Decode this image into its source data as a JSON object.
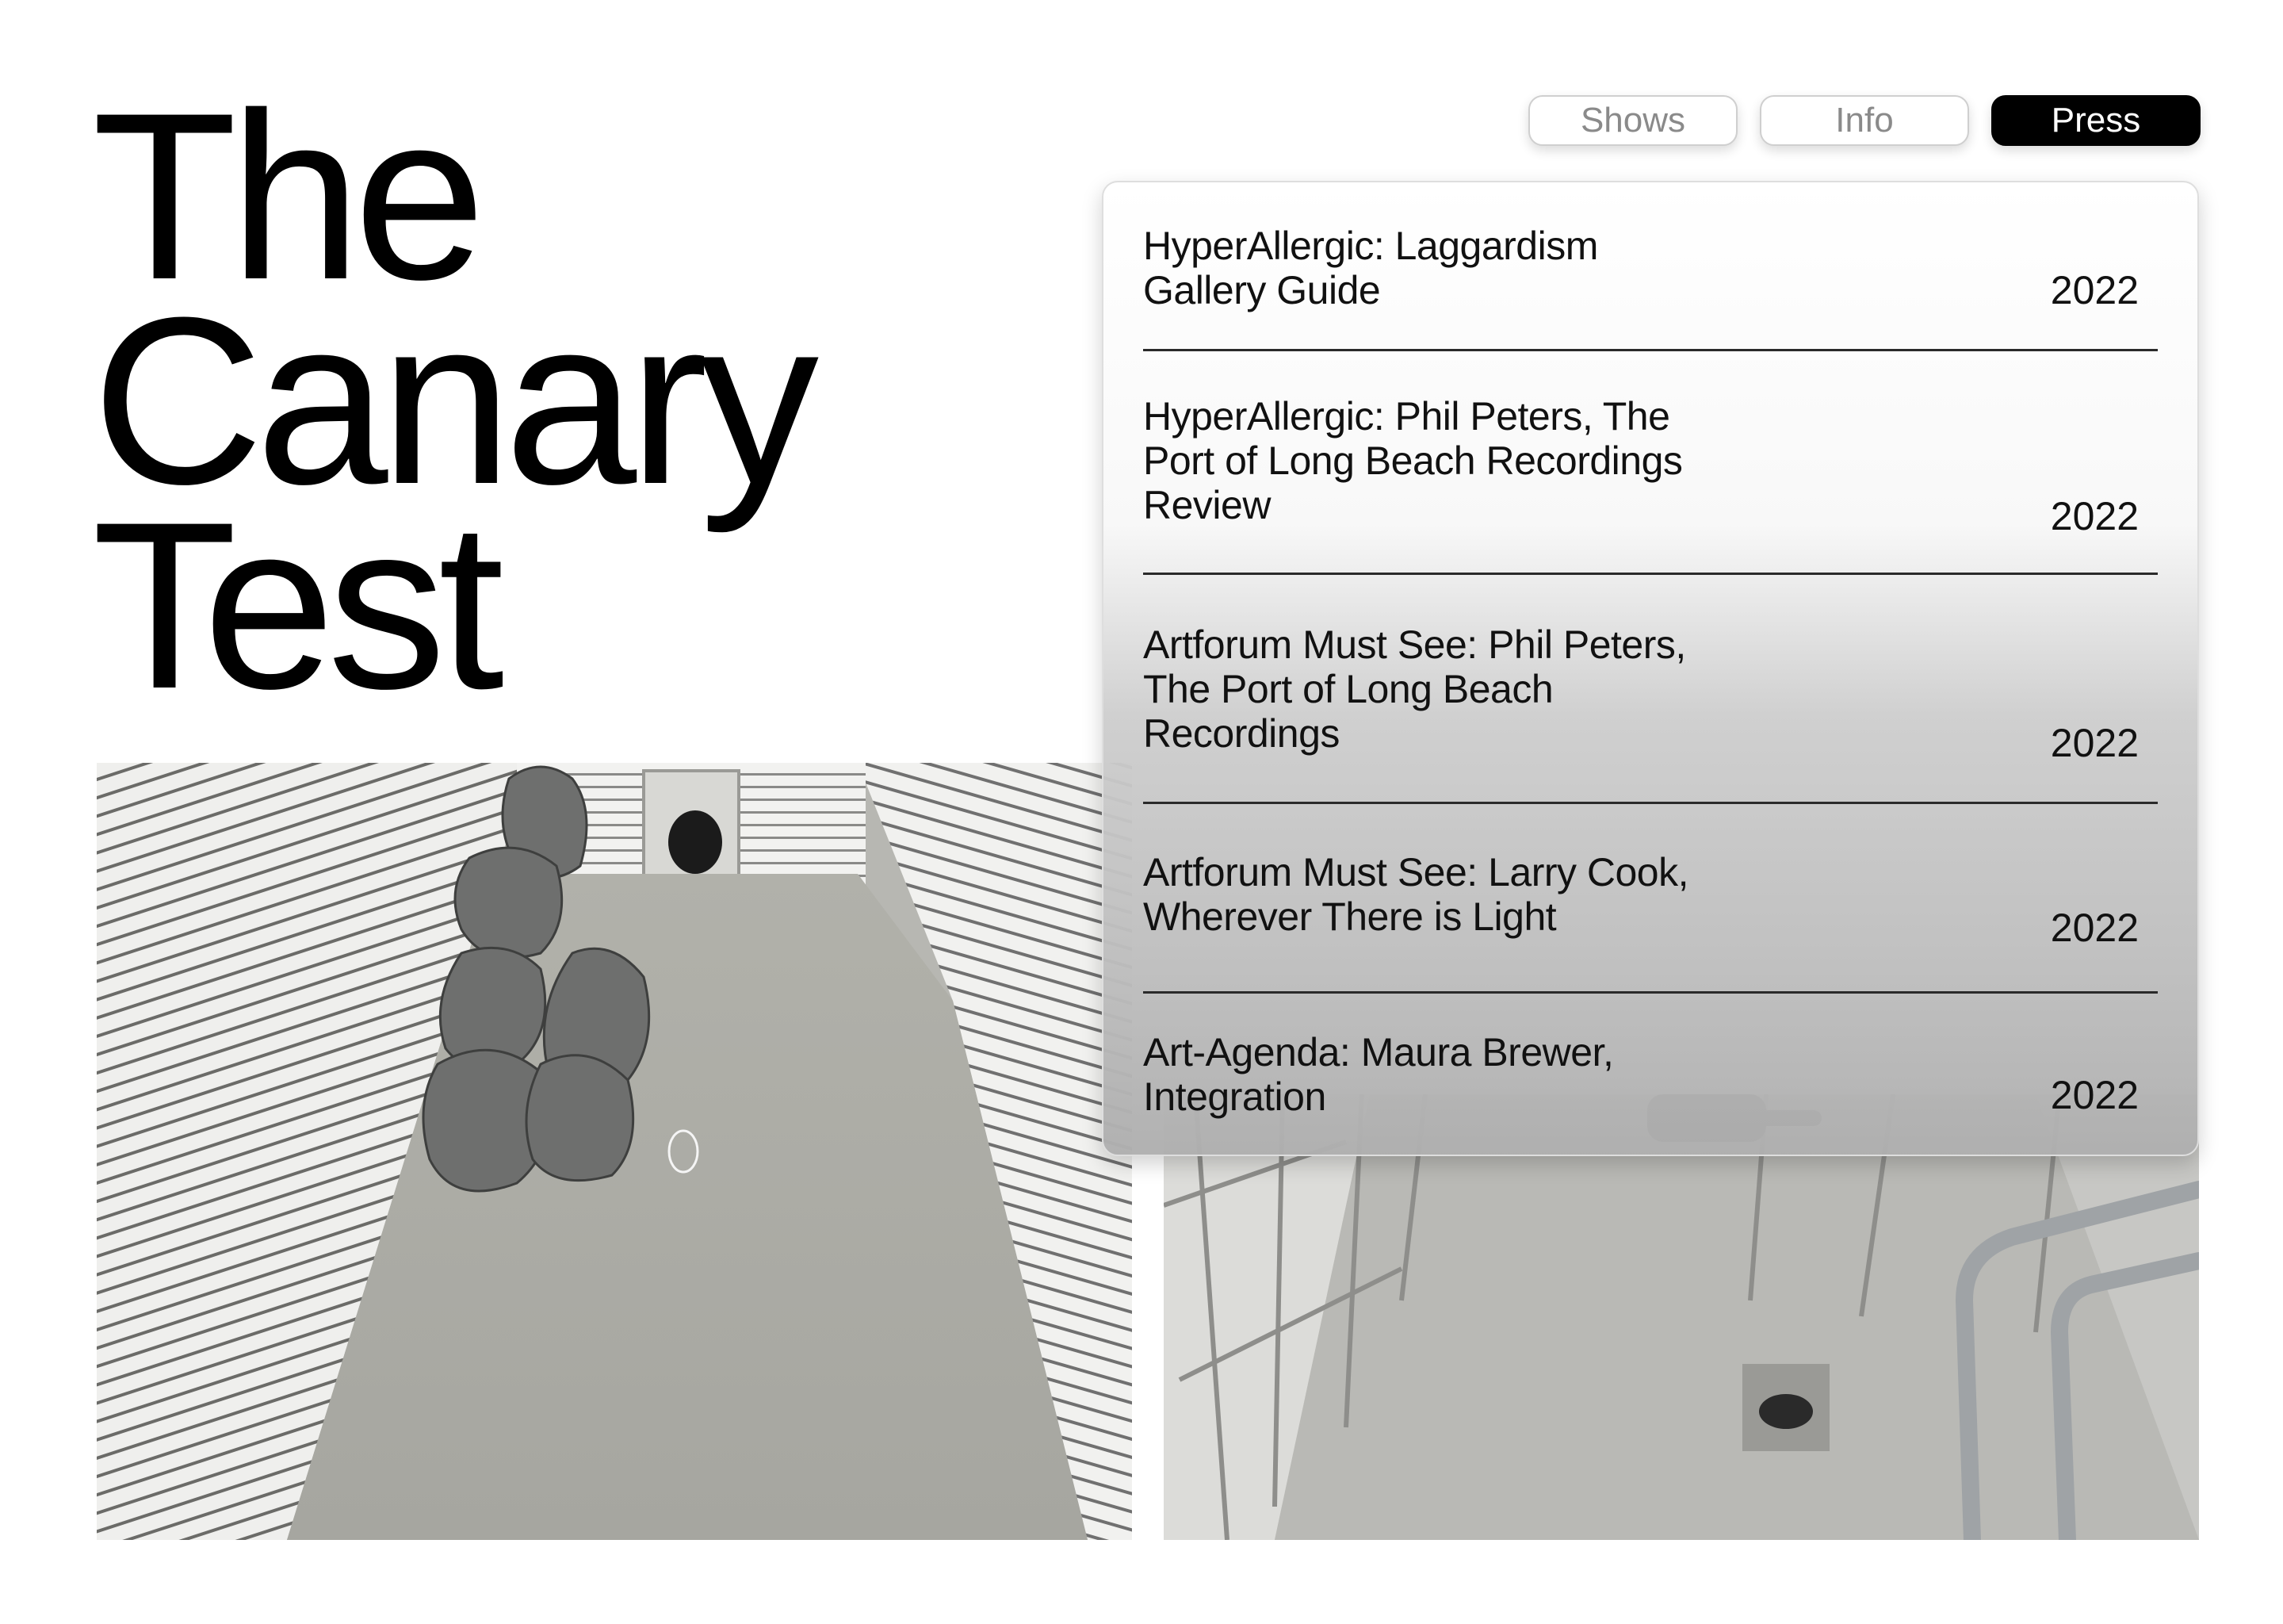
{
  "site": {
    "title_lines": [
      "The",
      "Canary",
      "Test"
    ]
  },
  "nav": {
    "items": [
      {
        "label": "Shows",
        "active": false
      },
      {
        "label": "Info",
        "active": false
      },
      {
        "label": "Press",
        "active": true
      }
    ]
  },
  "press": {
    "items": [
      {
        "title": "HyperAllergic: Laggardism Gallery Guide",
        "year": "2022"
      },
      {
        "title": "HyperAllergic: Phil Peters, The Port of Long Beach Recordings Review",
        "year": "2022"
      },
      {
        "title": "Artforum Must See: Phil Peters, The Port of Long Beach Recordings",
        "year": "2022"
      },
      {
        "title": "Artforum Must See: Larry Cook, Wherever There is Light",
        "year": "2022"
      },
      {
        "title": "Art-Agenda: Maura Brewer, Integration",
        "year": "2022"
      }
    ]
  },
  "colors": {
    "accent": "#000000",
    "background": "#ffffff",
    "inactive_text": "#8a8a8a"
  }
}
